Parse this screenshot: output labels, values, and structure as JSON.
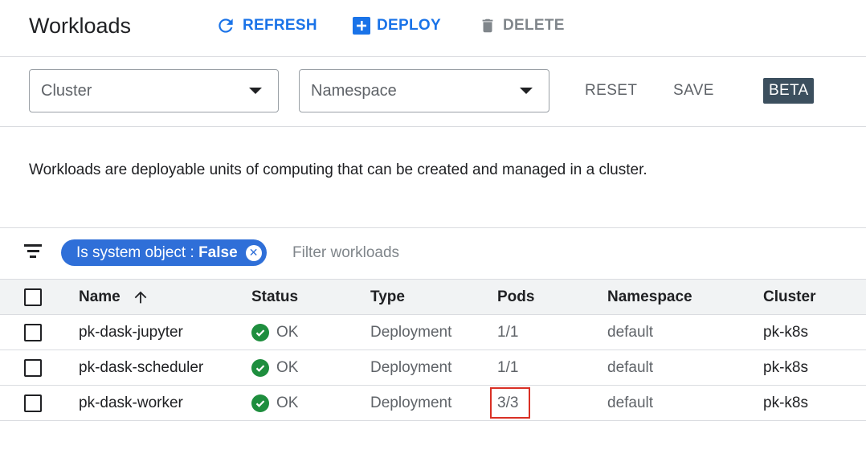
{
  "header": {
    "title": "Workloads",
    "refresh_label": "REFRESH",
    "deploy_label": "DEPLOY",
    "delete_label": "DELETE"
  },
  "toolbar": {
    "cluster_select": "Cluster",
    "namespace_select": "Namespace",
    "reset_label": "RESET",
    "save_label": "SAVE",
    "beta_badge": "BETA"
  },
  "description": "Workloads are deployable units of computing that can be created and managed in a cluster.",
  "filter": {
    "chip_key": "Is system object :",
    "chip_value": "False",
    "placeholder": "Filter workloads"
  },
  "table": {
    "columns": [
      "Name",
      "Status",
      "Type",
      "Pods",
      "Namespace",
      "Cluster"
    ],
    "rows": [
      {
        "name": "pk-dask-jupyter",
        "status": "OK",
        "type": "Deployment",
        "pods": "1/1",
        "namespace": "default",
        "cluster": "pk-k8s"
      },
      {
        "name": "pk-dask-scheduler",
        "status": "OK",
        "type": "Deployment",
        "pods": "1/1",
        "namespace": "default",
        "cluster": "pk-k8s"
      },
      {
        "name": "pk-dask-worker",
        "status": "OK",
        "type": "Deployment",
        "pods": "3/3",
        "namespace": "default",
        "cluster": "pk-k8s"
      }
    ]
  },
  "colors": {
    "accent": "#1a73e8",
    "chip": "#2f6fd8",
    "ok": "#1e8e3e",
    "highlight": "#d93025"
  },
  "icons": {
    "refresh": "refresh-icon",
    "deploy": "add-box-icon",
    "delete": "trash-icon",
    "sort": "arrow-up-icon",
    "status": "check-circle-icon",
    "filter": "filter-list-icon",
    "chip_close": "close-circle-icon"
  }
}
